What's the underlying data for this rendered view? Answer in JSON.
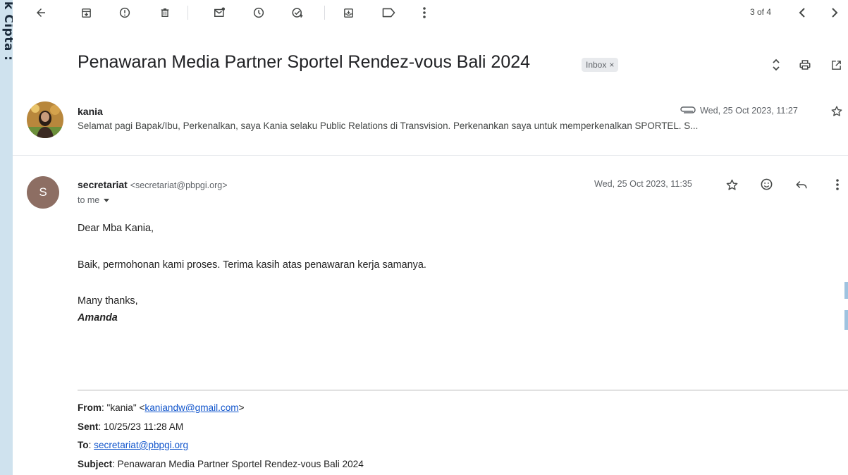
{
  "sidebar_strip": {
    "text": "k Cipta :"
  },
  "toolbar": {
    "icons": [
      "back-arrow-icon",
      "archive-icon",
      "report-spam-icon",
      "delete-icon",
      "mark-unread-icon",
      "snooze-icon",
      "add-task-icon",
      "move-to-icon",
      "label-icon",
      "more-vert-icon"
    ],
    "pager_text": "3 of 4"
  },
  "thread": {
    "subject": "Penawaran Media Partner Sportel Rendez-vous Bali 2024",
    "label_chip": "Inbox",
    "label_chip_close": "×"
  },
  "message1": {
    "sender": "kania",
    "snippet": "Selamat pagi Bapak/Ibu, Perkenalkan, saya Kania selaku Public Relations di Transvision. Perkenankan saya untuk memperkenalkan SPORTEL. S...",
    "date": "Wed, 25 Oct 2023, 11:27"
  },
  "message2": {
    "avatar_letter": "S",
    "sender_name": "secretariat",
    "sender_email": "<secretariat@pbpgi.org>",
    "recipient": "to me",
    "date": "Wed, 25 Oct 2023, 11:35",
    "body": {
      "greeting": "Dear Mba Kania,",
      "line1": "Baik, permohonan kami proses. Terima kasih atas penawaran kerja samanya.",
      "closing": "Many thanks,",
      "signature": "Amanda"
    },
    "quoted": {
      "from_label": "From",
      "from_name": ": \"kania\" <",
      "from_email": "kaniandw@gmail.com",
      "from_end": ">",
      "sent_label": "Sent",
      "sent_value": ": 10/25/23 11:28 AM",
      "to_label": "To",
      "to_sep": ": ",
      "to_value": "secretariat@pbpgi.org",
      "subject_label": "Subject",
      "subject_value": ": Penawaran Media Partner Sportel Rendez-vous Bali 2024"
    }
  },
  "colors": {
    "text_primary": "#202124",
    "text_secondary": "#5f6368",
    "link": "#1155cc",
    "avatar_s": "#8d6e63",
    "strip": "#cfe2ee"
  }
}
